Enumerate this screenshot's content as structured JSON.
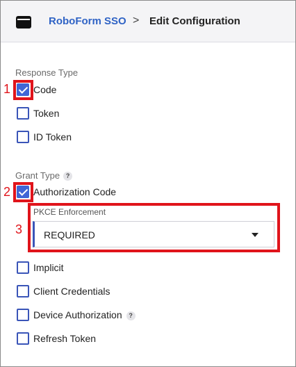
{
  "header": {
    "app_icon": "window-icon",
    "breadcrumb_link": "RoboForm SSO",
    "separator": ">",
    "current_page": "Edit Configuration"
  },
  "response_type": {
    "label": "Response Type",
    "options": [
      {
        "label": "Code",
        "checked": true
      },
      {
        "label": "Token",
        "checked": false
      },
      {
        "label": "ID Token",
        "checked": false
      }
    ]
  },
  "grant_type": {
    "label": "Grant Type",
    "help": "?",
    "options": [
      {
        "label": "Authorization Code",
        "checked": true
      },
      {
        "label": "Implicit",
        "checked": false
      },
      {
        "label": "Client Credentials",
        "checked": false
      },
      {
        "label": "Device Authorization",
        "checked": false,
        "help": "?"
      },
      {
        "label": "Refresh Token",
        "checked": false
      }
    ]
  },
  "pkce": {
    "label": "PKCE Enforcement",
    "value": "REQUIRED"
  },
  "annotations": [
    "1",
    "2",
    "3"
  ],
  "colors": {
    "accent": "#3f66d6",
    "link": "#2f63c5",
    "annotation": "#e0141b",
    "header_bg": "#f4f4f6"
  }
}
